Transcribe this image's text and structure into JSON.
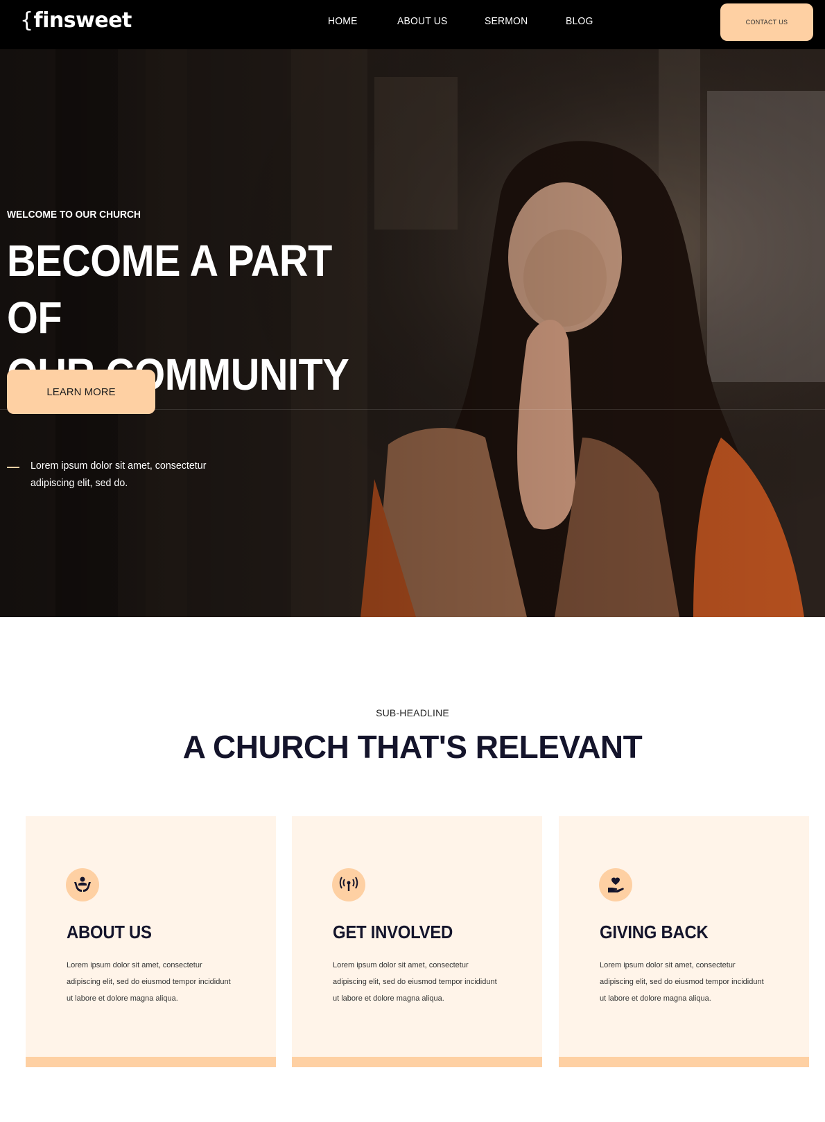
{
  "nav": {
    "logo_brace": "{",
    "logo_text": "finsweet",
    "links": [
      {
        "label": "HOME"
      },
      {
        "label": "ABOUT US"
      },
      {
        "label": "SERMON"
      },
      {
        "label": "BLOG"
      }
    ],
    "contact_label": "CONTACT US"
  },
  "hero": {
    "welcome": "WELCOME TO OUR CHURCH",
    "title_line1": "BECOME A PART OF",
    "title_line2": "OUR COMMUNITY",
    "button_label": "LEARN MORE",
    "description": "Lorem ipsum dolor sit amet, consectetur adipiscing elit, sed do."
  },
  "section": {
    "sub_headline": "SUB-HEADLINE",
    "title": "A CHURCH THAT'S RELEVANT"
  },
  "cards": [
    {
      "icon": "hands-holding-people-icon",
      "title": "ABOUT US",
      "text": "Lorem ipsum dolor sit amet, consectetur adipiscing elit, sed do eiusmod tempor incididunt ut labore et dolore magna aliqua."
    },
    {
      "icon": "broadcast-antenna-icon",
      "title": "GET INVOLVED",
      "text": "Lorem ipsum dolor sit amet, consectetur adipiscing elit, sed do eiusmod tempor incididunt ut labore et dolore magna aliqua."
    },
    {
      "icon": "hand-holding-heart-icon",
      "title": "GIVING BACK",
      "text": "Lorem ipsum dolor sit amet, consectetur adipiscing elit, sed do eiusmod tempor incididunt ut labore et dolore magna aliqua."
    }
  ],
  "colors": {
    "accent": "#fed0a3",
    "card_bg": "#fff4e9",
    "dark": "#14142b",
    "nav_bg": "#000000"
  }
}
